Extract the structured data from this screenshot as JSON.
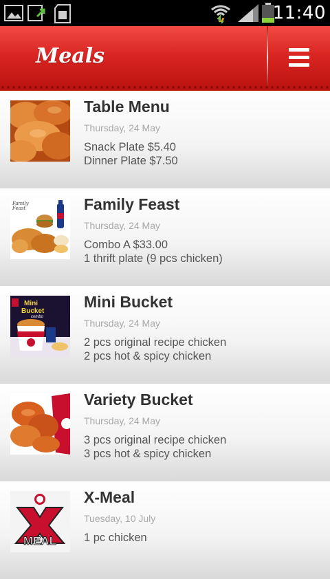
{
  "status_bar": {
    "time": "11:40",
    "icons": [
      "gallery-icon",
      "sync-icon",
      "sd-card-icon",
      "wifi-icon",
      "signal-icon",
      "battery-icon"
    ]
  },
  "header": {
    "title": "Meals",
    "menu_icon": "hamburger-menu-icon",
    "colors": {
      "header_red": "#d92521",
      "title_text": "#ffffff"
    }
  },
  "meals": [
    {
      "name": "Table Menu",
      "date": "Thursday, 24 May",
      "lines": [
        "Snack Plate $5.40",
        "Dinner Plate $7.50"
      ],
      "thumb": "fried-chicken-photo"
    },
    {
      "name": "Family Feast",
      "date": "Thursday, 24 May",
      "lines": [
        "Combo A $33.00",
        "1 thrift plate (9 pcs chicken)"
      ],
      "thumb": "family-feast-photo",
      "thumb_caption": "Family Feast"
    },
    {
      "name": "Mini Bucket",
      "date": "Thursday, 24 May",
      "lines": [
        "2 pcs original recipe chicken",
        "2 pcs hot & spicy chicken"
      ],
      "thumb": "mini-bucket-photo",
      "thumb_caption": "Mini Bucket combo"
    },
    {
      "name": "Variety Bucket",
      "date": "Thursday, 24 May",
      "lines": [
        "3 pcs original recipe chicken",
        "3 pcs hot & spicy chicken"
      ],
      "thumb": "variety-bucket-photo"
    },
    {
      "name": "X-Meal",
      "date": "Tuesday, 10 July",
      "lines": [
        "1 pc chicken"
      ],
      "thumb": "x-meal-logo",
      "thumb_caption": "MEAL"
    }
  ]
}
